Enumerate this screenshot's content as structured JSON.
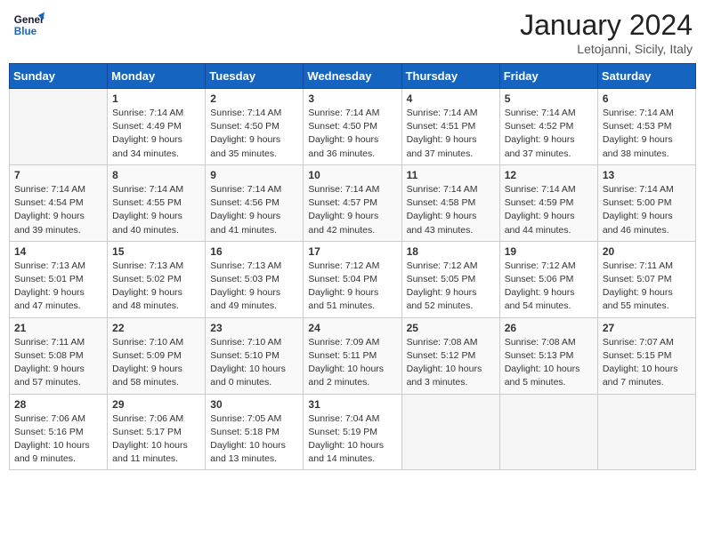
{
  "header": {
    "logo_line1": "General",
    "logo_line2": "Blue",
    "month_title": "January 2024",
    "location": "Letojanni, Sicily, Italy"
  },
  "weekdays": [
    "Sunday",
    "Monday",
    "Tuesday",
    "Wednesday",
    "Thursday",
    "Friday",
    "Saturday"
  ],
  "weeks": [
    [
      {
        "day": "",
        "sunrise": "",
        "sunset": "",
        "daylight": ""
      },
      {
        "day": "1",
        "sunrise": "Sunrise: 7:14 AM",
        "sunset": "Sunset: 4:49 PM",
        "daylight": "Daylight: 9 hours and 34 minutes."
      },
      {
        "day": "2",
        "sunrise": "Sunrise: 7:14 AM",
        "sunset": "Sunset: 4:50 PM",
        "daylight": "Daylight: 9 hours and 35 minutes."
      },
      {
        "day": "3",
        "sunrise": "Sunrise: 7:14 AM",
        "sunset": "Sunset: 4:50 PM",
        "daylight": "Daylight: 9 hours and 36 minutes."
      },
      {
        "day": "4",
        "sunrise": "Sunrise: 7:14 AM",
        "sunset": "Sunset: 4:51 PM",
        "daylight": "Daylight: 9 hours and 37 minutes."
      },
      {
        "day": "5",
        "sunrise": "Sunrise: 7:14 AM",
        "sunset": "Sunset: 4:52 PM",
        "daylight": "Daylight: 9 hours and 37 minutes."
      },
      {
        "day": "6",
        "sunrise": "Sunrise: 7:14 AM",
        "sunset": "Sunset: 4:53 PM",
        "daylight": "Daylight: 9 hours and 38 minutes."
      }
    ],
    [
      {
        "day": "7",
        "sunrise": "Sunrise: 7:14 AM",
        "sunset": "Sunset: 4:54 PM",
        "daylight": "Daylight: 9 hours and 39 minutes."
      },
      {
        "day": "8",
        "sunrise": "Sunrise: 7:14 AM",
        "sunset": "Sunset: 4:55 PM",
        "daylight": "Daylight: 9 hours and 40 minutes."
      },
      {
        "day": "9",
        "sunrise": "Sunrise: 7:14 AM",
        "sunset": "Sunset: 4:56 PM",
        "daylight": "Daylight: 9 hours and 41 minutes."
      },
      {
        "day": "10",
        "sunrise": "Sunrise: 7:14 AM",
        "sunset": "Sunset: 4:57 PM",
        "daylight": "Daylight: 9 hours and 42 minutes."
      },
      {
        "day": "11",
        "sunrise": "Sunrise: 7:14 AM",
        "sunset": "Sunset: 4:58 PM",
        "daylight": "Daylight: 9 hours and 43 minutes."
      },
      {
        "day": "12",
        "sunrise": "Sunrise: 7:14 AM",
        "sunset": "Sunset: 4:59 PM",
        "daylight": "Daylight: 9 hours and 44 minutes."
      },
      {
        "day": "13",
        "sunrise": "Sunrise: 7:14 AM",
        "sunset": "Sunset: 5:00 PM",
        "daylight": "Daylight: 9 hours and 46 minutes."
      }
    ],
    [
      {
        "day": "14",
        "sunrise": "Sunrise: 7:13 AM",
        "sunset": "Sunset: 5:01 PM",
        "daylight": "Daylight: 9 hours and 47 minutes."
      },
      {
        "day": "15",
        "sunrise": "Sunrise: 7:13 AM",
        "sunset": "Sunset: 5:02 PM",
        "daylight": "Daylight: 9 hours and 48 minutes."
      },
      {
        "day": "16",
        "sunrise": "Sunrise: 7:13 AM",
        "sunset": "Sunset: 5:03 PM",
        "daylight": "Daylight: 9 hours and 49 minutes."
      },
      {
        "day": "17",
        "sunrise": "Sunrise: 7:12 AM",
        "sunset": "Sunset: 5:04 PM",
        "daylight": "Daylight: 9 hours and 51 minutes."
      },
      {
        "day": "18",
        "sunrise": "Sunrise: 7:12 AM",
        "sunset": "Sunset: 5:05 PM",
        "daylight": "Daylight: 9 hours and 52 minutes."
      },
      {
        "day": "19",
        "sunrise": "Sunrise: 7:12 AM",
        "sunset": "Sunset: 5:06 PM",
        "daylight": "Daylight: 9 hours and 54 minutes."
      },
      {
        "day": "20",
        "sunrise": "Sunrise: 7:11 AM",
        "sunset": "Sunset: 5:07 PM",
        "daylight": "Daylight: 9 hours and 55 minutes."
      }
    ],
    [
      {
        "day": "21",
        "sunrise": "Sunrise: 7:11 AM",
        "sunset": "Sunset: 5:08 PM",
        "daylight": "Daylight: 9 hours and 57 minutes."
      },
      {
        "day": "22",
        "sunrise": "Sunrise: 7:10 AM",
        "sunset": "Sunset: 5:09 PM",
        "daylight": "Daylight: 9 hours and 58 minutes."
      },
      {
        "day": "23",
        "sunrise": "Sunrise: 7:10 AM",
        "sunset": "Sunset: 5:10 PM",
        "daylight": "Daylight: 10 hours and 0 minutes."
      },
      {
        "day": "24",
        "sunrise": "Sunrise: 7:09 AM",
        "sunset": "Sunset: 5:11 PM",
        "daylight": "Daylight: 10 hours and 2 minutes."
      },
      {
        "day": "25",
        "sunrise": "Sunrise: 7:08 AM",
        "sunset": "Sunset: 5:12 PM",
        "daylight": "Daylight: 10 hours and 3 minutes."
      },
      {
        "day": "26",
        "sunrise": "Sunrise: 7:08 AM",
        "sunset": "Sunset: 5:13 PM",
        "daylight": "Daylight: 10 hours and 5 minutes."
      },
      {
        "day": "27",
        "sunrise": "Sunrise: 7:07 AM",
        "sunset": "Sunset: 5:15 PM",
        "daylight": "Daylight: 10 hours and 7 minutes."
      }
    ],
    [
      {
        "day": "28",
        "sunrise": "Sunrise: 7:06 AM",
        "sunset": "Sunset: 5:16 PM",
        "daylight": "Daylight: 10 hours and 9 minutes."
      },
      {
        "day": "29",
        "sunrise": "Sunrise: 7:06 AM",
        "sunset": "Sunset: 5:17 PM",
        "daylight": "Daylight: 10 hours and 11 minutes."
      },
      {
        "day": "30",
        "sunrise": "Sunrise: 7:05 AM",
        "sunset": "Sunset: 5:18 PM",
        "daylight": "Daylight: 10 hours and 13 minutes."
      },
      {
        "day": "31",
        "sunrise": "Sunrise: 7:04 AM",
        "sunset": "Sunset: 5:19 PM",
        "daylight": "Daylight: 10 hours and 14 minutes."
      },
      {
        "day": "",
        "sunrise": "",
        "sunset": "",
        "daylight": ""
      },
      {
        "day": "",
        "sunrise": "",
        "sunset": "",
        "daylight": ""
      },
      {
        "day": "",
        "sunrise": "",
        "sunset": "",
        "daylight": ""
      }
    ]
  ]
}
